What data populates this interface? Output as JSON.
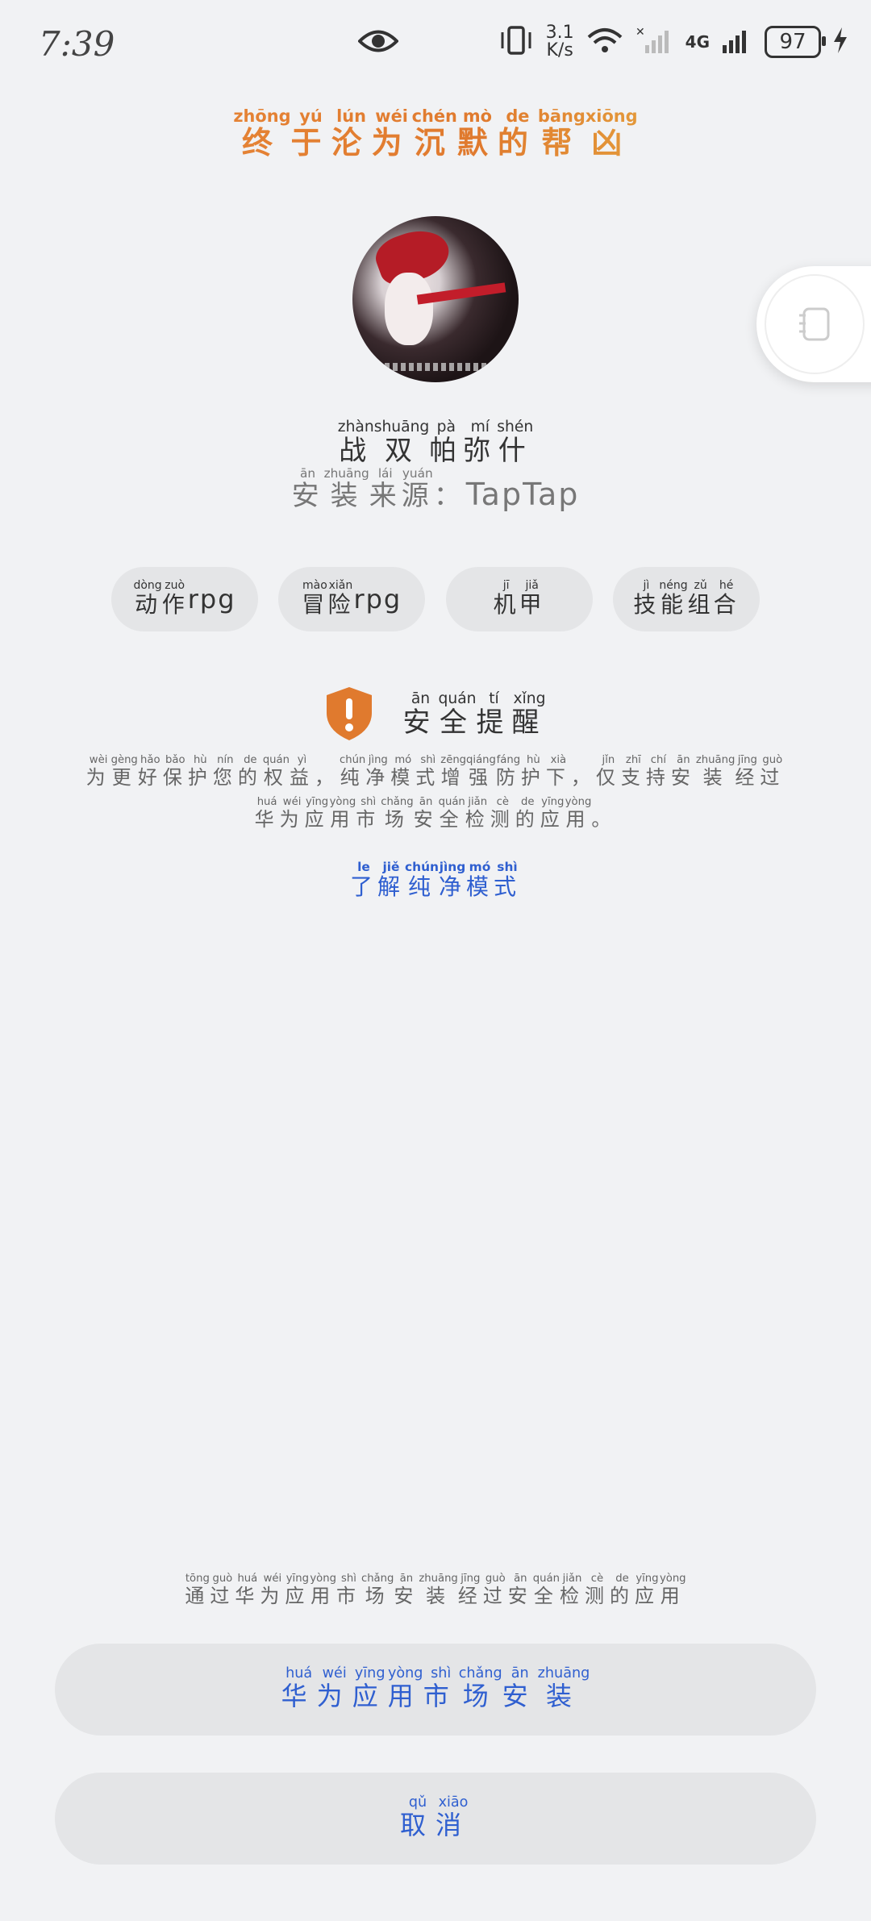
{
  "status_bar": {
    "time": "7:39",
    "speed_value": "3.1",
    "speed_unit": "K/s",
    "network": "4G",
    "battery": "97",
    "icons": [
      "eye-icon",
      "vibrate-icon",
      "wifi-icon",
      "signal-icon",
      "signal-icon",
      "battery-icon",
      "charging-icon"
    ]
  },
  "heading": {
    "text": "终于沦为沉默的帮凶",
    "pinyin": [
      "zhōng",
      "yú",
      "lún",
      "wéi",
      "chén",
      "mò",
      "de",
      "bāng",
      "xiōng"
    ]
  },
  "app": {
    "name": "战双帕弥什",
    "name_pinyin": [
      "zhàn",
      "shuāng",
      "pà",
      "mí",
      "shén"
    ],
    "source_label": "安装来源：",
    "source_label_pinyin": [
      "ān",
      "zhuāng",
      "lái",
      "yuán",
      ""
    ],
    "source_value": "TapTap"
  },
  "tags": [
    {
      "cn": "动作",
      "pinyin": [
        "dòng",
        "zuò"
      ],
      "latin": "rpg"
    },
    {
      "cn": "冒险",
      "pinyin": [
        "mào",
        "xiǎn"
      ],
      "latin": "rpg"
    },
    {
      "cn": "机甲",
      "pinyin": [
        "jī",
        "jiǎ"
      ],
      "latin": ""
    },
    {
      "cn": "技能组合",
      "pinyin": [
        "jì",
        "néng",
        "zǔ",
        "hé"
      ],
      "latin": ""
    }
  ],
  "security": {
    "title": "安全提醒",
    "title_pinyin": [
      "ān",
      "quán",
      "tí",
      "xǐng"
    ],
    "line1": "为更好保护您的权益，纯净模式增强防护下，仅支持安装经过",
    "line1_pinyin": [
      "wèi",
      "gèng",
      "hǎo",
      "bǎo",
      "hù",
      "nín",
      "de",
      "quán",
      "yì",
      "",
      "chún",
      "jìng",
      "mó",
      "shì",
      "zēng",
      "qiáng",
      "fáng",
      "hù",
      "xià",
      "",
      "jǐn",
      "zhī",
      "chí",
      "ān",
      "zhuāng",
      "jīng",
      "guò"
    ],
    "line2": "华为应用市场安全检测的应用。",
    "line2_pinyin": [
      "huá",
      "wéi",
      "yīng",
      "yòng",
      "shì",
      "chǎng",
      "ān",
      "quán",
      "jiǎn",
      "cè",
      "de",
      "yīng",
      "yòng",
      ""
    ],
    "learn_more": "了解纯净模式",
    "learn_more_pinyin": [
      "le",
      "jiě",
      "chún",
      "jìng",
      "mó",
      "shì"
    ],
    "shield_color": "#e07a2e"
  },
  "footer": {
    "note": "通过华为应用市场安装经过安全检测的应用",
    "note_pinyin": [
      "tōng",
      "guò",
      "huá",
      "wéi",
      "yīng",
      "yòng",
      "shì",
      "chǎng",
      "ān",
      "zhuāng",
      "jīng",
      "guò",
      "ān",
      "quán",
      "jiǎn",
      "cè",
      "de",
      "yīng",
      "yòng"
    ],
    "install_button": "华为应用市场安装",
    "install_button_pinyin": [
      "huá",
      "wéi",
      "yīng",
      "yòng",
      "shì",
      "chǎng",
      "ān",
      "zhuāng"
    ],
    "cancel_button": "取消",
    "cancel_button_pinyin": [
      "qǔ",
      "xiāo"
    ],
    "accent_color": "#2f5fd0"
  }
}
